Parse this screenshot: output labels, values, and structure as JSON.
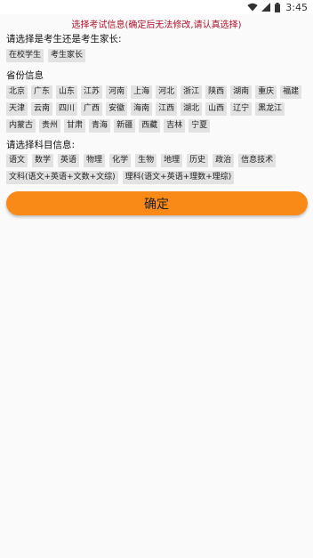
{
  "status_bar": {
    "time": "3:45",
    "icons": [
      "wifi-icon",
      "signal-icon",
      "battery-icon"
    ]
  },
  "notice": "选择考试信息(确定后无法修改,请认真选择)",
  "user_type": {
    "title": "请选择是考生还是考生家长:",
    "options": [
      "在校学生",
      "考生家长"
    ]
  },
  "province": {
    "title": "省份信息",
    "options": [
      "北京",
      "广东",
      "山东",
      "江苏",
      "河南",
      "上海",
      "河北",
      "浙江",
      "陕西",
      "湖南",
      "重庆",
      "福建",
      "天津",
      "云南",
      "四川",
      "广西",
      "安徽",
      "海南",
      "江西",
      "湖北",
      "山西",
      "辽宁",
      "黑龙江",
      "内蒙古",
      "贵州",
      "甘肃",
      "青海",
      "新疆",
      "西藏",
      "吉林",
      "宁夏"
    ]
  },
  "subject": {
    "title": "请选择科目信息:",
    "options": [
      "语文",
      "数学",
      "英语",
      "物理",
      "化学",
      "生物",
      "地理",
      "历史",
      "政治",
      "信息技术"
    ],
    "combos": [
      "文科(语文+英语+文数+文综)",
      "理科(语文+英语+理数+理综)"
    ]
  },
  "confirm_label": "确定",
  "colors": {
    "accent": "#f98a18",
    "notice": "#b0102a",
    "chip_bg": "#e2e2e2"
  }
}
